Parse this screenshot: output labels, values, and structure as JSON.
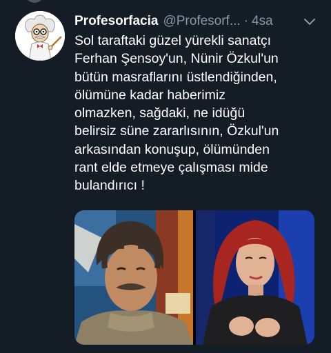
{
  "tweet": {
    "display_name": "Profesorfacia",
    "handle": "@Profesorf...",
    "separator": "·",
    "time": "4sa",
    "text_lines": [
      "Sol taraftaki güzel yürekli sanatçı",
      "Ferhan Şensoy'un, Nünir Özkul'un",
      "bütün masraflarını üstlendiğinden,",
      "ölümüne kadar haberimiz",
      "olmazken, sağdaki, ne idüğü",
      "belirsiz süne zararlısının, Özkul'un",
      "arkasından konuşup, ölümünden",
      "rant elde etmeye çalışması mide",
      "bulandırıcı !"
    ]
  },
  "icons": {
    "avatar": "cartoon-professor-avatar",
    "menu": "chevron-down-icon"
  },
  "colors": {
    "background": "#141d26",
    "text": "#ffffff",
    "secondary_text": "#8899a6"
  }
}
